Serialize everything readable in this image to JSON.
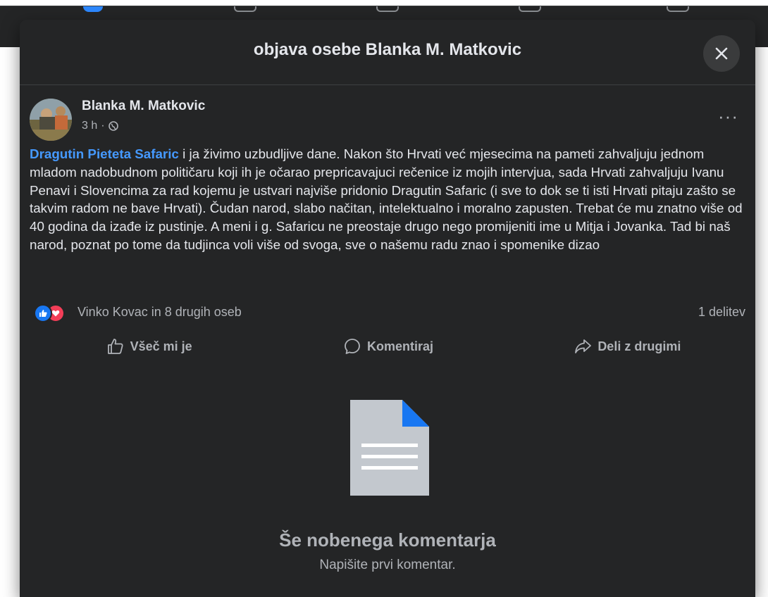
{
  "modal": {
    "title": "objava osebe Blanka M. Matkovic",
    "close_icon": "close-icon"
  },
  "post": {
    "author": "Blanka M. Matkovic",
    "time": "3 h",
    "separator": "·",
    "privacy_icon": "globe-icon",
    "more_icon": "more-icon",
    "more_label": "···",
    "mention": "Dragutin Pieteta Safaric",
    "text": " i ja živimo uzbudljive dane. Nakon što Hrvati već mjesecima na pameti zahvaljuju jednom mladom nadobudnom političaru koji ih je očarao prepricavajuci rečenice iz mojih intervjua, sada Hrvati zahvaljuju Ivanu Penavi i Slovencima za rad kojemu je ustvari najviše pridonio Dragutin Safaric (i sve to dok se ti isti Hrvati pitaju zašto se takvim radom ne bave Hrvati). Čudan narod, slabo načitan, intelektualno i moralno zapusten. Trebat će mu znatno više od 40 godina da izađe iz pustinje. A meni i g. Safaricu ne preostaje drugo nego promijeniti ime u Mitja i Jovanka. Tad bi naš narod, poznat po tome da tudjinca voli više od svoga, sve o našemu radu znao i spomenike dizao"
  },
  "reactions": {
    "summary": "Vinko Kovac in 8 drugih oseb",
    "shares": "1 delitev",
    "icons": [
      "like-icon",
      "love-icon"
    ]
  },
  "actions": {
    "like": "Všeč mi je",
    "comment": "Komentiraj",
    "share": "Deli z drugimi"
  },
  "comments": {
    "empty_title": "Še nobenega komentarja",
    "empty_subtitle": "Napišite prvi komentar."
  },
  "colors": {
    "modal_bg": "#242526",
    "text": "#e4e6eb",
    "secondary_text": "#b0b3b8",
    "mention": "#4599ff",
    "like": "#1877f2",
    "love": "#f33e58"
  }
}
